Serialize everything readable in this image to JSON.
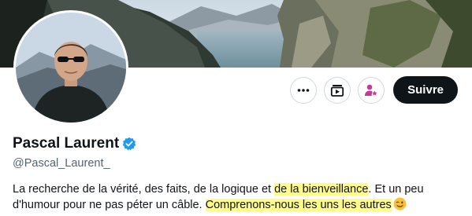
{
  "profile": {
    "display_name": "Pascal Laurent",
    "handle": "@Pascal_Laurent_",
    "verified_color": "#1d9bf0"
  },
  "actions": {
    "more_icon": "more-horizontal-icon",
    "subscribe_icon": "subscription-icon",
    "notify_icon": "profile-star-icon",
    "notify_color": "#c2399c",
    "follow_label": "Suivre"
  },
  "bio": {
    "part1": "La recherche de la vérité, des faits, de la logique et ",
    "part2_highlight": "de la bienveillance",
    "part3": ". Et un peu d'humour pour ne pas péter un câble. ",
    "part4_highlight": "Comprenons-nous les uns les autres",
    "emoji": "winking-face-emoji",
    "highlight_color": "#fffb8a"
  }
}
